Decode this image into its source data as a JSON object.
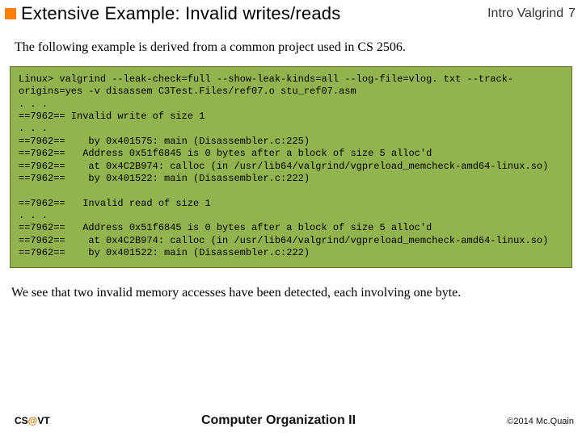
{
  "header": {
    "title": "Extensive Example: Invalid writes/reads",
    "section": "Intro Valgrind",
    "page": "7"
  },
  "intro": "The following example is derived from a common project used in CS 2506.",
  "code": "Linux> valgrind --leak-check=full --show-leak-kinds=all --log-file=vlog. txt --track-origins=yes -v disassem C3Test.Files/ref07.o stu_ref07.asm\n. . .\n==7962== Invalid write of size 1\n. . .\n==7962==    by 0x401575: main (Disassembler.c:225)\n==7962==   Address 0x51f6845 is 0 bytes after a block of size 5 alloc'd\n==7962==    at 0x4C2B974: calloc (in /usr/lib64/valgrind/vgpreload_memcheck-amd64-linux.so)\n==7962==    by 0x401522: main (Disassembler.c:222)\n\n==7962==   Invalid read of size 1\n. . .\n==7962==   Address 0x51f6845 is 0 bytes after a block of size 5 alloc'd\n==7962==    at 0x4C2B974: calloc (in /usr/lib64/valgrind/vgpreload_memcheck-amd64-linux.so)\n==7962==    by 0x401522: main (Disassembler.c:222)",
  "aftertext": "We see that two invalid memory accesses have been detected, each involving one byte.",
  "footer": {
    "left_pre": "CS",
    "left_at": "@",
    "left_post": "VT",
    "center": "Computer Organization II",
    "right": "©2014 Mc.Quain"
  }
}
